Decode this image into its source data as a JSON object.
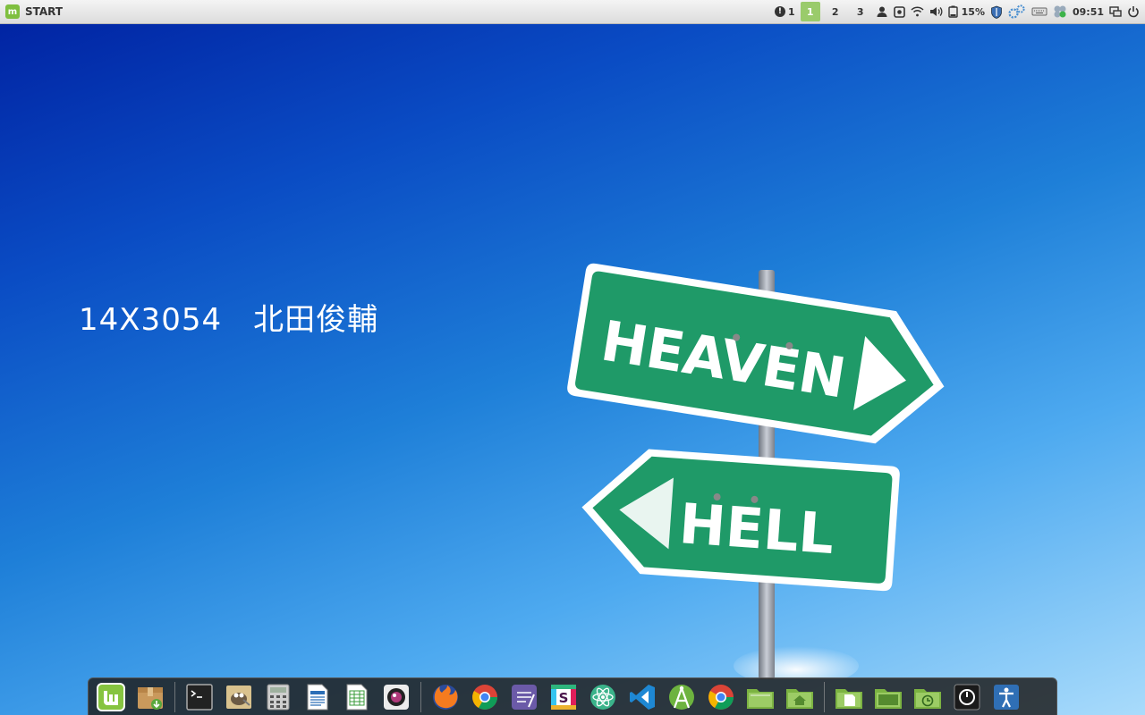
{
  "panel": {
    "start_label": "START",
    "alerts_count": "1",
    "workspaces": [
      "1",
      "2",
      "3"
    ],
    "active_workspace": "1",
    "battery_percent": "15%",
    "clock": "09:51",
    "icons": [
      "alert-icon",
      "user-icon",
      "screenshot-icon",
      "wifi-icon",
      "volume-icon",
      "battery-icon",
      "shield-icon",
      "network-settings-icon",
      "keyboard-icon",
      "bluetooth-icon",
      "window-list-icon",
      "power-icon"
    ]
  },
  "desktop": {
    "label": "14X3054　北田俊輔"
  },
  "wallpaper": {
    "sign_top": "HEAVEN",
    "sign_bottom": "HELL",
    "sign_color": "#1f9a68"
  },
  "dock": {
    "items": [
      "linux-mint-menu-icon",
      "software-manager-icon",
      "terminal-icon",
      "gimp-icon",
      "calculator-icon",
      "libreoffice-writer-icon",
      "libreoffice-calc-icon",
      "camera-icon",
      "firefox-icon",
      "chrome-icon",
      "text-editor-icon",
      "slack-icon",
      "atom-icon",
      "vscode-icon",
      "android-studio-icon",
      "chromium-icon",
      "files-icon",
      "home-folder-icon",
      "document-folder-icon",
      "desktop-folder-icon",
      "history-folder-icon",
      "shutdown-icon",
      "accessibility-icon"
    ]
  }
}
